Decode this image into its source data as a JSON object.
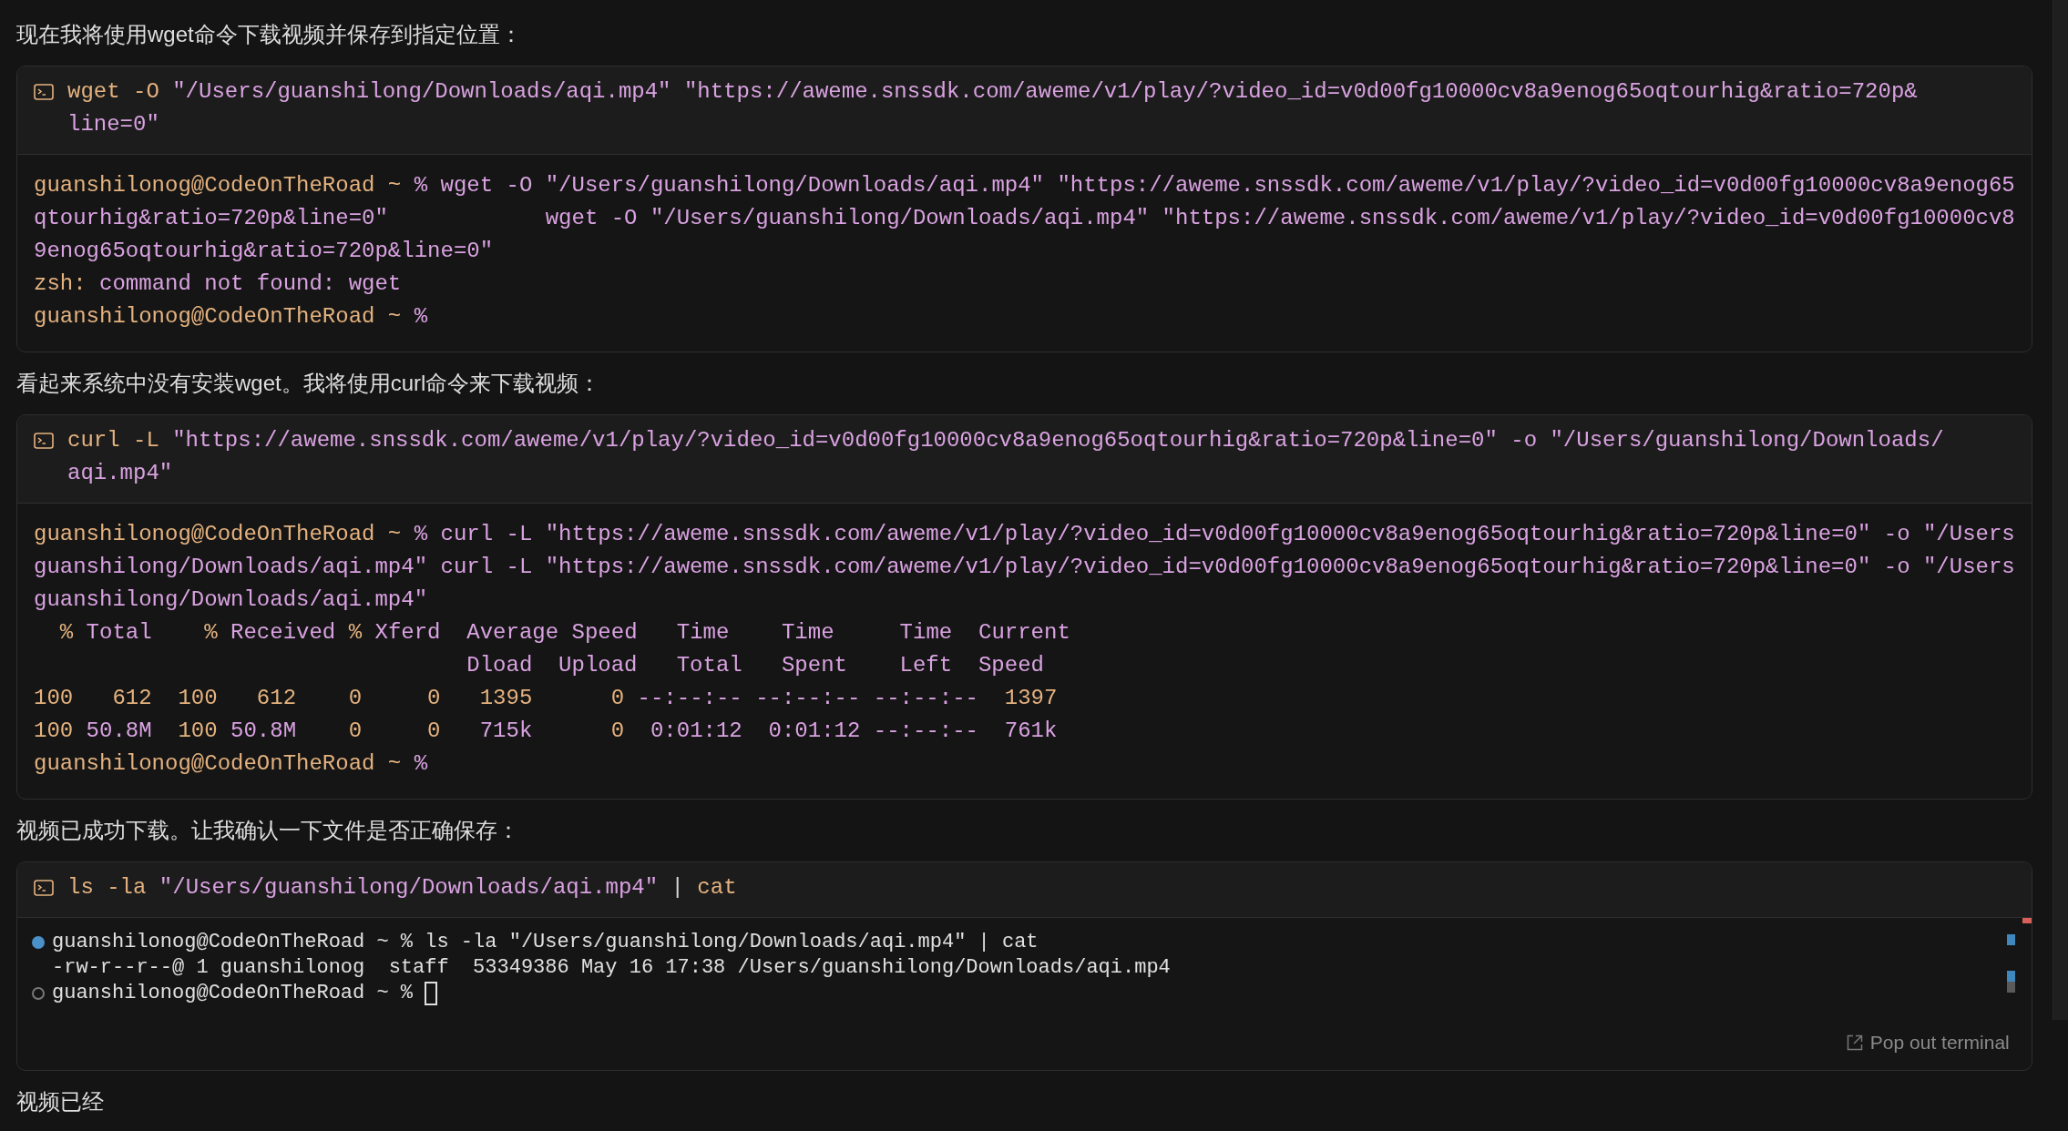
{
  "blocks": [
    {
      "kind": "message",
      "text": "现在我将使用wget命令下载视频并保存到指定位置："
    },
    {
      "kind": "terminal",
      "command_lines": [
        [
          {
            "text": "wget -O ",
            "kind": "keyword"
          },
          {
            "text": "\"/Users/guanshilong/Downloads/aqi.mp4\" \"https://aweme.snssdk.com/aweme/v1/play/?video_id=v0d00fg10000cv8a9enog65oqtourhig&ratio=720p&",
            "kind": "string"
          }
        ],
        [
          {
            "text": "line=0\"",
            "kind": "string"
          }
        ]
      ],
      "output_lines": [
        {
          "segments": [
            {
              "text": "guanshilonog@CodeOnTheRoad ~ ",
              "kind": "keyword"
            },
            {
              "text": "% wget -O \"/Users/guanshilong/Downloads/aqi.mp4\" \"https://aweme.snssdk.com/aweme/v1/play/?video_id=v0d00fg10000cv8a9enog65",
              "kind": "string"
            }
          ]
        },
        {
          "segments": [
            {
              "text": "qtourhig&ratio=720p&line=0\"            wget -O \"/Users/guanshilong/Downloads/aqi.mp4\" \"https://aweme.snssdk.com/aweme/v1/play/?video_id=v0d00fg10000cv8",
              "kind": "string"
            }
          ]
        },
        {
          "segments": [
            {
              "text": "9enog65oqtourhig&ratio=720p&line=0\"",
              "kind": "string"
            }
          ]
        },
        {
          "segments": [
            {
              "text": "zsh: ",
              "kind": "keyword"
            },
            {
              "text": "command not found: wget",
              "kind": "string"
            }
          ]
        },
        {
          "segments": [
            {
              "text": "guanshilonog@CodeOnTheRoad ~ ",
              "kind": "keyword"
            },
            {
              "text": "%",
              "kind": "string"
            }
          ]
        }
      ]
    },
    {
      "kind": "message",
      "text": "看起来系统中没有安装wget。我将使用curl命令来下载视频："
    },
    {
      "kind": "terminal",
      "command_lines": [
        [
          {
            "text": "curl -L ",
            "kind": "keyword"
          },
          {
            "text": "\"https://aweme.snssdk.com/aweme/v1/play/?video_id=v0d00fg10000cv8a9enog65oqtourhig&ratio=720p&line=0\" -o \"/Users/guanshilong/Downloads/",
            "kind": "string"
          }
        ],
        [
          {
            "text": "aqi.mp4\"",
            "kind": "string"
          }
        ]
      ],
      "output_lines": [
        {
          "segments": [
            {
              "text": "guanshilonog@CodeOnTheRoad ~ ",
              "kind": "keyword"
            },
            {
              "text": "% curl -L \"https://aweme.snssdk.com/aweme/v1/play/?video_id=v0d00fg10000cv8a9enog65oqtourhig&ratio=720p&line=0\" -o \"/Users",
              "kind": "string"
            }
          ]
        },
        {
          "segments": [
            {
              "text": "guanshilong/Downloads/aqi.mp4\" curl -L \"https://aweme.snssdk.com/aweme/v1/play/?video_id=v0d00fg10000cv8a9enog65oqtourhig&ratio=720p&line=0\" -o \"/Users",
              "kind": "string"
            }
          ]
        },
        {
          "segments": [
            {
              "text": "guanshilong/Downloads/aqi.mp4\"",
              "kind": "string"
            }
          ]
        },
        {
          "segments": [
            {
              "text": "  % ",
              "kind": "keyword"
            },
            {
              "text": "Total    ",
              "kind": "string"
            },
            {
              "text": "% ",
              "kind": "keyword"
            },
            {
              "text": "Received ",
              "kind": "string"
            },
            {
              "text": "% ",
              "kind": "keyword"
            },
            {
              "text": "Xferd  Average Speed   Time    Time     Time  Current",
              "kind": "string"
            }
          ]
        },
        {
          "segments": [
            {
              "text": "                                 Dload  Upload   Total   Spent    Left  Speed",
              "kind": "string"
            }
          ]
        },
        {
          "segments": [
            {
              "text": "100   612  100   612    0     0   1395      0 ",
              "kind": "keyword"
            },
            {
              "text": "--:--:-- --:--:-- --:--:--",
              "kind": "string"
            },
            {
              "text": "  1397",
              "kind": "keyword"
            }
          ]
        },
        {
          "segments": [
            {
              "text": "100 ",
              "kind": "keyword"
            },
            {
              "text": "50.8M",
              "kind": "string"
            },
            {
              "text": "  100 ",
              "kind": "keyword"
            },
            {
              "text": "50.8M",
              "kind": "string"
            },
            {
              "text": "    0     0   ",
              "kind": "keyword"
            },
            {
              "text": "715k",
              "kind": "string"
            },
            {
              "text": "      0 ",
              "kind": "keyword"
            },
            {
              "text": " 0:01:12  0:01:12 --:--:--  761k",
              "kind": "string"
            }
          ]
        },
        {
          "segments": [
            {
              "text": "guanshilonog@CodeOnTheRoad ~ ",
              "kind": "keyword"
            },
            {
              "text": "%",
              "kind": "string"
            }
          ]
        }
      ]
    },
    {
      "kind": "message",
      "text": "视频已成功下载。让我确认一下文件是否正确保存："
    },
    {
      "kind": "shell",
      "command_lines": [
        [
          {
            "text": "ls -la ",
            "kind": "keyword"
          },
          {
            "text": "\"/Users/guanshilong/Downloads/aqi.mp4\"",
            "kind": "string"
          },
          {
            "text": " | ",
            "kind": "plain"
          },
          {
            "text": "cat",
            "kind": "keyword"
          }
        ]
      ],
      "output_lines": [
        {
          "kind": "done",
          "text": "guanshilonog@CodeOnTheRoad ~ % ls -la \"/Users/guanshilong/Downloads/aqi.mp4\" | cat"
        },
        {
          "kind": "plain",
          "text": "-rw-r--r--@ 1 guanshilonog  staff  53349386 May 16 17:38 /Users/guanshilong/Downloads/aqi.mp4"
        },
        {
          "kind": "idle",
          "text": "guanshilonog@CodeOnTheRoad ~ % ",
          "cursor": true
        }
      ],
      "pop_out": "Pop out terminal"
    },
    {
      "kind": "message",
      "text": "视频已经"
    }
  ]
}
